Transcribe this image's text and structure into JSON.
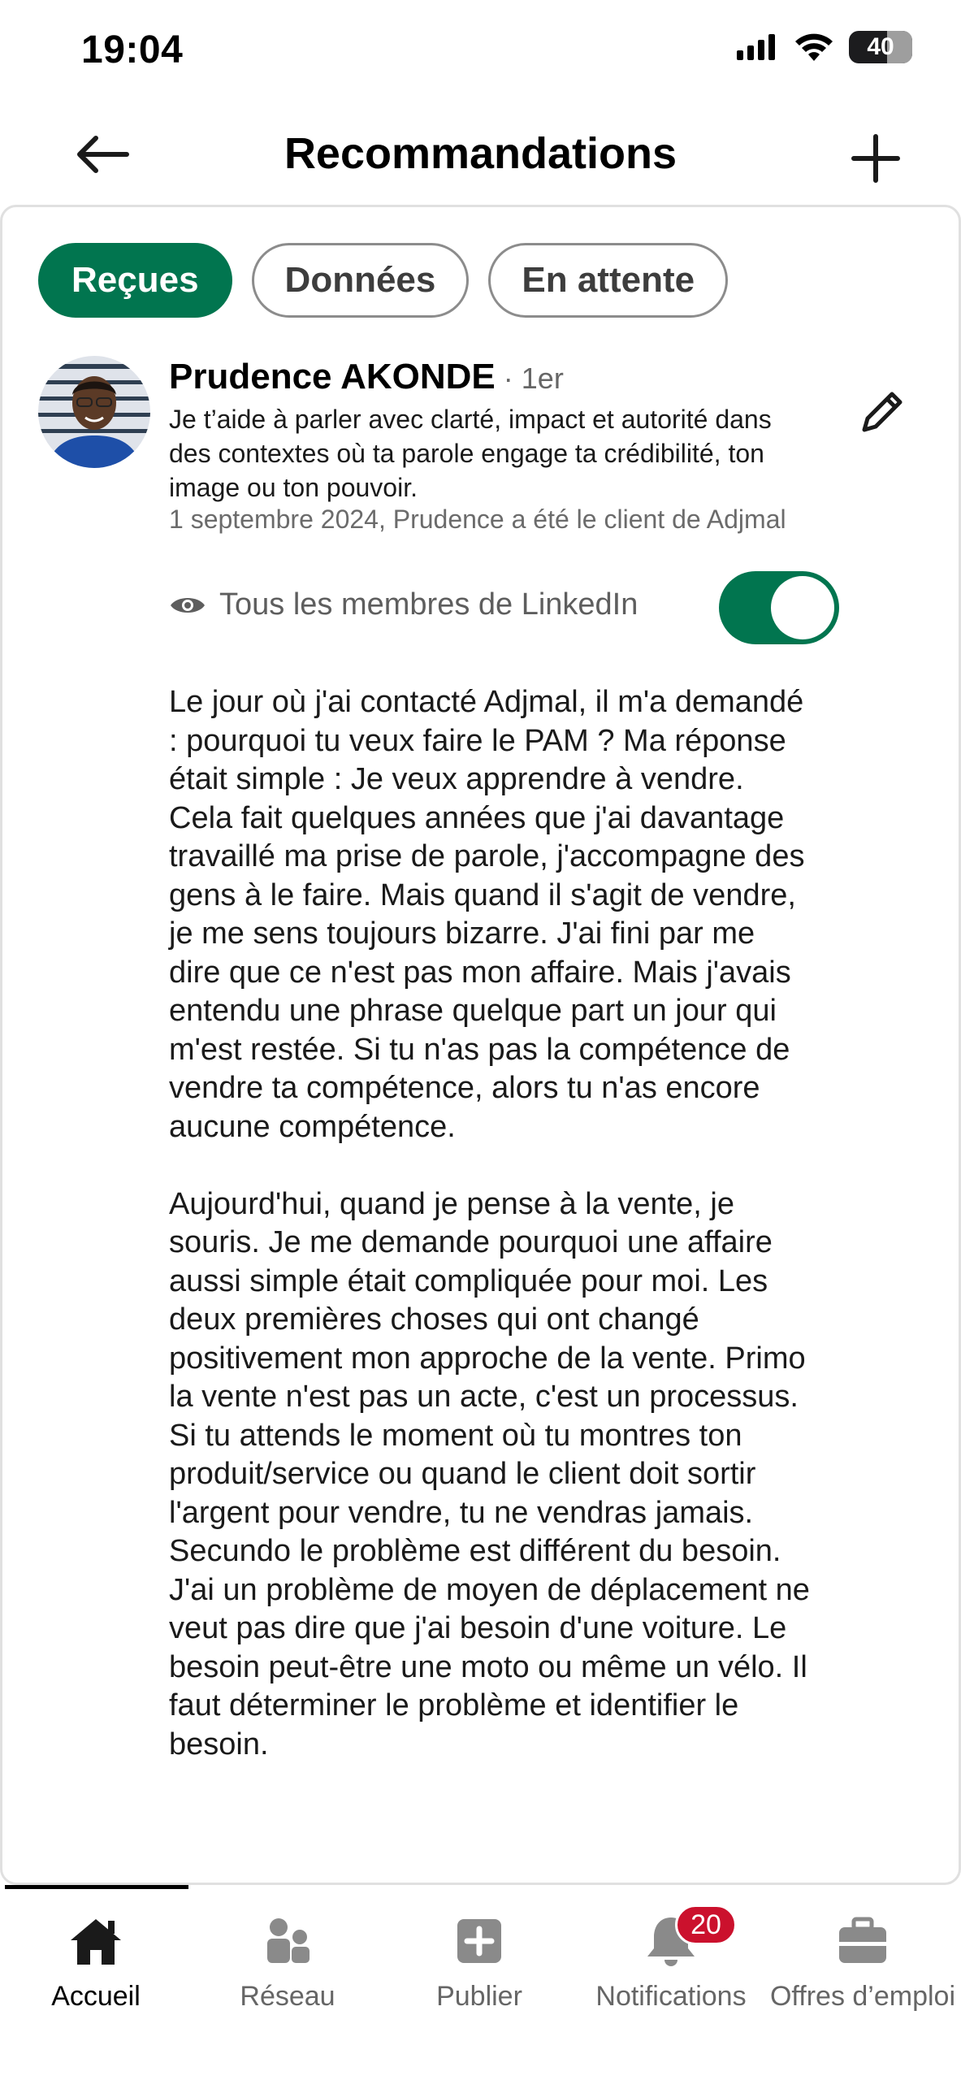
{
  "status_bar": {
    "time": "19:04",
    "battery": "40"
  },
  "header": {
    "title": "Recommandations"
  },
  "tabs": [
    {
      "label": "Reçues",
      "active": true
    },
    {
      "label": "Données",
      "active": false
    },
    {
      "label": "En attente",
      "active": false
    }
  ],
  "recommendation": {
    "name": "Prudence AKONDE",
    "degree": "· 1er",
    "headline": "Je t’aide à parler avec clarté, impact et autorité dans des contextes où ta parole engage ta crédibilité, ton image ou ton pouvoir.",
    "meta": "1 septembre 2024, Prudence a été le client de Adjmal",
    "visibility_label": "Tous les membres de LinkedIn",
    "visibility_enabled": true,
    "text": "Le jour où j'ai contacté Adjmal, il m'a demandé : pourquoi tu veux faire le PAM ? Ma réponse était simple : Je veux apprendre à vendre. Cela fait quelques années que j'ai davantage travaillé ma prise de parole, j'accompagne des gens à le faire. Mais quand il s'agit de vendre, je me sens toujours bizarre. J'ai fini par me dire que ce n'est pas mon affaire. Mais j'avais entendu une phrase quelque part un jour qui m'est restée. Si tu n'as pas la compétence de vendre ta compétence, alors tu n'as encore aucune compétence.\n\nAujourd'hui, quand je pense à la vente, je souris. Je me demande pourquoi une affaire aussi simple était compliquée pour moi. Les deux premières choses qui ont changé positivement mon approche de la vente. Primo la vente n'est pas un acte, c'est un processus. Si tu attends le moment où tu montres ton produit/service ou quand le client doit sortir l'argent pour vendre, tu ne vendras jamais. Secundo le problème est différent du besoin. J'ai un problème de moyen de déplacement ne veut pas dire que j'ai besoin d'une voiture. Le besoin peut-être une moto ou même un vélo. Il faut déterminer le problème et identifier le besoin."
  },
  "bottom_nav": [
    {
      "label": "Accueil",
      "icon": "home-icon",
      "active": true
    },
    {
      "label": "Réseau",
      "icon": "network-icon",
      "active": false
    },
    {
      "label": "Publier",
      "icon": "post-icon",
      "active": false
    },
    {
      "label": "Notifications",
      "icon": "bell-icon",
      "active": false,
      "badge": "20"
    },
    {
      "label": "Offres d’emploi",
      "icon": "briefcase-icon",
      "active": false
    }
  ],
  "colors": {
    "accent": "#01754f",
    "badge": "#cb112d"
  }
}
